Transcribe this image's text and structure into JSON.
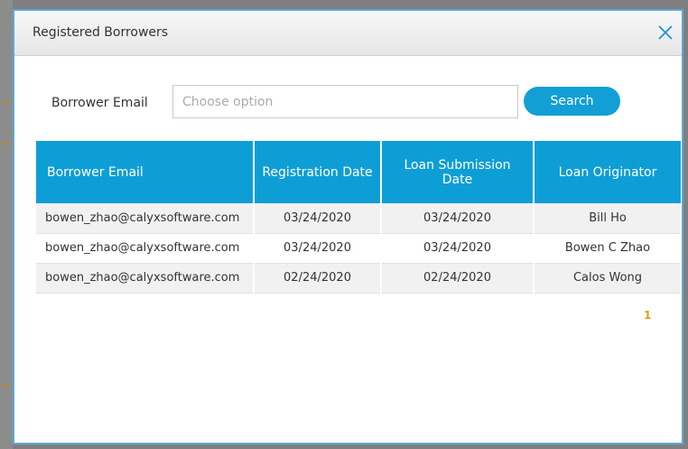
{
  "modal": {
    "title": "Registered Borrowers",
    "close_icon": "close-icon"
  },
  "filter": {
    "label": "Borrower Email",
    "placeholder": "Choose option",
    "value": "",
    "search_label": "Search"
  },
  "table": {
    "headers": [
      "Borrower Email",
      "Registration Date",
      "Loan Submission Date",
      "Loan Originator"
    ],
    "rows": [
      [
        "bowen_zhao@calyxsoftware.com",
        "03/24/2020",
        "03/24/2020",
        "Bill Ho"
      ],
      [
        "bowen_zhao@calyxsoftware.com",
        "03/24/2020",
        "03/24/2020",
        "Bowen C Zhao"
      ],
      [
        "bowen_zhao@calyxsoftware.com",
        "02/24/2020",
        "02/24/2020",
        "Calos Wong"
      ]
    ]
  },
  "pagination": {
    "current_page": "1"
  },
  "colors": {
    "header_blue": "#0e9ed6",
    "button_blue": "#119fd6",
    "page_orange": "#e09a1a",
    "modal_border": "#5aaad8"
  }
}
